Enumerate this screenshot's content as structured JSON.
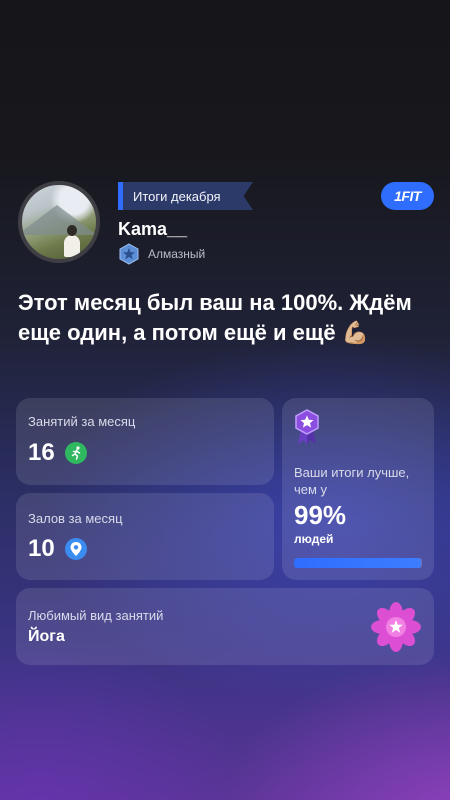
{
  "header": {
    "tag": "Итоги декабря",
    "brand": "1FIT",
    "username": "Kama__",
    "rank": "Алмазный"
  },
  "headline": "Этот месяц был ваш на 100%. Ждём еще один, а потом ещё и ещё 💪🏼",
  "stats": {
    "sessions_label": "Занятий за месяц",
    "sessions_value": "16",
    "gyms_label": "Залов за месяц",
    "gyms_value": "10",
    "better_text": "Ваши итоги лучше, чем у",
    "better_pct": "99%",
    "better_people": "людей",
    "better_progress": 0.99,
    "favorite_label": "Любимый вид занятий",
    "favorite_value": "Йога"
  },
  "icons": {
    "sessions": "running-person-icon",
    "gyms": "location-pin-icon",
    "rank": "diamond-badge-icon",
    "medal": "star-medal-icon",
    "favorite": "lotus-icon"
  },
  "colors": {
    "accent": "#2f6dff",
    "running_icon": "#2fb85f",
    "lotus": "#e44fd6"
  }
}
